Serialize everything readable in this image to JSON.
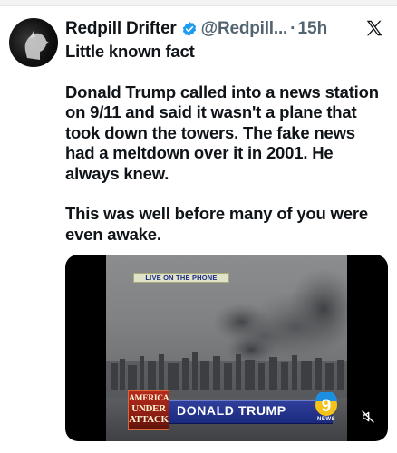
{
  "tweet": {
    "display_name": "Redpill Drifter",
    "handle": "@Redpill...",
    "separator": "·",
    "time": "15h",
    "paragraphs": [
      "Little known fact",
      "Donald Trump called into a news station on 9/11 and said it wasn't a plane that took down the towers. The fake news had a meltdown over it in 2001. He always knew.",
      "This was well before many of you were even awake."
    ]
  },
  "video": {
    "live_label": "LIVE ON THE PHONE",
    "banner_line1": "AMERICA",
    "banner_line2": "UNDER",
    "banner_line3": "ATTACK",
    "ticker_name": "DONALD TRUMP",
    "station_logo_number": "9",
    "station_logo_word": "NEWS"
  },
  "colors": {
    "text_primary": "#0f1419",
    "text_secondary": "#536471",
    "verified_blue": "#1d9bf0",
    "ticker_blue": "#1a2a7e",
    "attack_red": "#b52a1d"
  },
  "icons": [
    "verified-badge-icon",
    "x-logo-icon",
    "mute-icon"
  ]
}
